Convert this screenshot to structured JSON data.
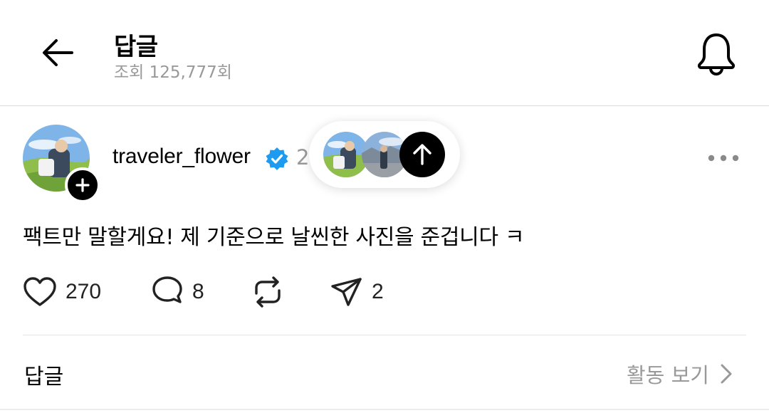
{
  "header": {
    "title": "답글",
    "views": "조회 125,777회"
  },
  "post": {
    "username": "traveler_flower",
    "time_partial": "2",
    "text": "팩트만 말할게요! 제 기준으로 날씬한 사진을 준겁니다 ㅋ",
    "likes": "270",
    "replies": "8",
    "shares": "2"
  },
  "footer": {
    "reply_label": "답글",
    "activity_link": "활동 보기"
  },
  "colors": {
    "verified": "#1d9bf0",
    "muted_text": "#999999",
    "divider": "#e3e3e3"
  },
  "icons": [
    "back-arrow-icon",
    "bell-icon",
    "verified-badge-icon",
    "plus-icon",
    "up-arrow-icon",
    "more-icon",
    "heart-icon",
    "comment-icon",
    "repost-icon",
    "send-icon",
    "chevron-right-icon"
  ]
}
